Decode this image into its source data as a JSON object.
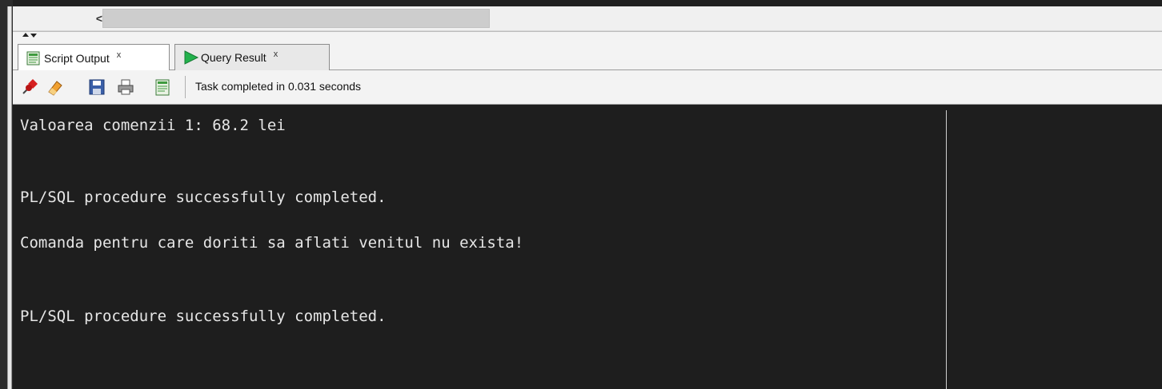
{
  "scrollbar": {
    "left_arrow": "<"
  },
  "tabs": [
    {
      "label": "Script Output",
      "close": "x",
      "icon": "script-output-icon"
    },
    {
      "label": "Query Result",
      "close": "x",
      "icon": "run-triangle-icon"
    }
  ],
  "toolbar": {
    "icons": [
      "pin-icon",
      "eraser-icon",
      "save-icon",
      "print-icon",
      "script-document-icon"
    ],
    "status": "Task completed in 0.031 seconds"
  },
  "output": {
    "lines": [
      "Valoarea comenzii 1: 68.2 lei",
      "PL/SQL procedure successfully completed.",
      "Comanda pentru care doriti sa aflati venitul nu exista!",
      "PL/SQL procedure successfully completed."
    ]
  },
  "colors": {
    "background": "#202020",
    "output_bg": "#1e1e1e",
    "output_text": "#e6e6e6",
    "panel": "#f3f3f3",
    "run_green": "#22b14c"
  }
}
